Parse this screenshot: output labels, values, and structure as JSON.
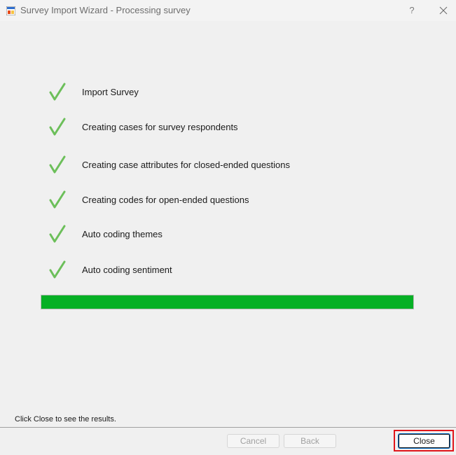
{
  "window": {
    "title": "Survey Import Wizard - Processing survey",
    "help_label": "?"
  },
  "steps": [
    {
      "label": "Import Survey",
      "icon": "checkmark-icon",
      "done": true
    },
    {
      "label": "Creating cases for survey respondents",
      "icon": "checkmark-icon",
      "done": true
    },
    {
      "label": "Creating case attributes for closed-ended questions",
      "icon": "checkmark-icon",
      "done": true
    },
    {
      "label": "Creating codes for open-ended questions",
      "icon": "checkmark-icon",
      "done": true
    },
    {
      "label": "Auto coding themes",
      "icon": "checkmark-icon",
      "done": true
    },
    {
      "label": "Auto coding sentiment",
      "icon": "checkmark-icon",
      "done": true
    }
  ],
  "progress": {
    "value_percent": 100,
    "fill_color": "#06b025"
  },
  "status": {
    "message": "Click Close to see the results."
  },
  "buttons": {
    "cancel_label": "Cancel",
    "back_label": "Back",
    "close_label": "Close"
  },
  "colors": {
    "check": "#6cbf5a",
    "highlight": "#e0161b"
  }
}
